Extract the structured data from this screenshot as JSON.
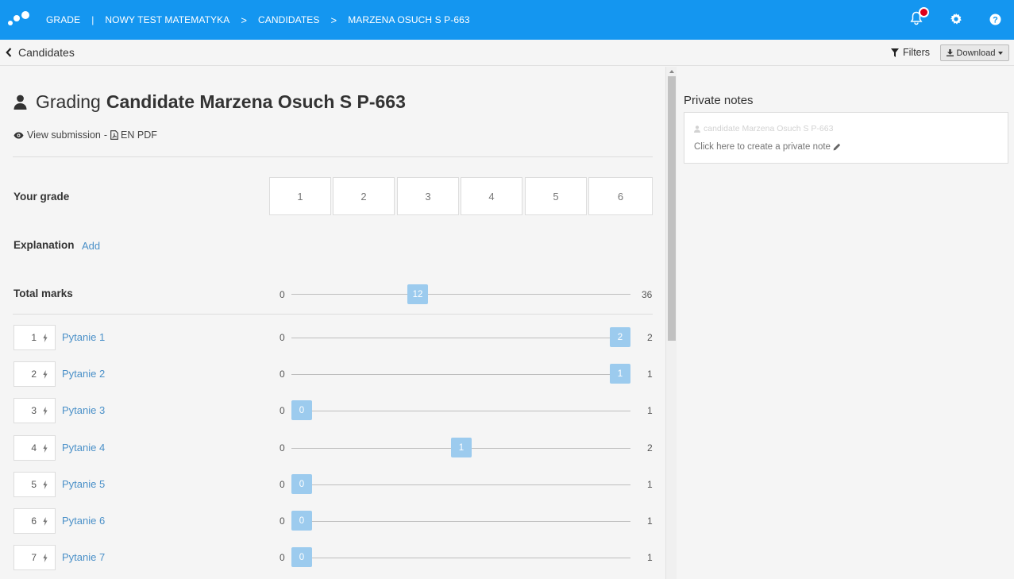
{
  "topbar": {
    "breadcrumbs": [
      "GRADE",
      "NOWY TEST MATEMATYKA",
      "CANDIDATES",
      "MARZENA OSUCH S P-663"
    ],
    "separator": "|",
    "chevron": ">",
    "icons": [
      "logo-icon",
      "bell-icon",
      "gear-icon",
      "help-icon"
    ],
    "accent_color": "#1496f0",
    "notification_dot_color": "#e0001b"
  },
  "subbar": {
    "back_label": "Candidates",
    "filters_label": "Filters",
    "download_label": "Download"
  },
  "header": {
    "prefix": "Grading",
    "candidate": "Candidate Marzena Osuch S P-663",
    "view_submission": "View submission",
    "dash": "-",
    "pdf_label": "EN PDF"
  },
  "grade": {
    "label": "Your grade",
    "options": [
      "1",
      "2",
      "3",
      "4",
      "5",
      "6"
    ]
  },
  "explanation": {
    "label": "Explanation",
    "add_label": "Add"
  },
  "total": {
    "label": "Total marks",
    "min": "0",
    "max": "36",
    "value": "12"
  },
  "questions": [
    {
      "index": "1",
      "label": "Pytanie 1",
      "min": "0",
      "max": "2",
      "value": "2"
    },
    {
      "index": "2",
      "label": "Pytanie 2",
      "min": "0",
      "max": "1",
      "value": "1"
    },
    {
      "index": "3",
      "label": "Pytanie 3",
      "min": "0",
      "max": "1",
      "value": "0"
    },
    {
      "index": "4",
      "label": "Pytanie 4",
      "min": "0",
      "max": "2",
      "value": "1"
    },
    {
      "index": "5",
      "label": "Pytanie 5",
      "min": "0",
      "max": "1",
      "value": "0"
    },
    {
      "index": "6",
      "label": "Pytanie 6",
      "min": "0",
      "max": "1",
      "value": "0"
    },
    {
      "index": "7",
      "label": "Pytanie 7",
      "min": "0",
      "max": "1",
      "value": "0"
    }
  ],
  "private_notes": {
    "title": "Private notes",
    "user": "candidate Marzena Osuch S P-663",
    "create": "Click here to create a private note"
  },
  "slider_color": "#9ccbee",
  "link_color": "#4a90c8"
}
